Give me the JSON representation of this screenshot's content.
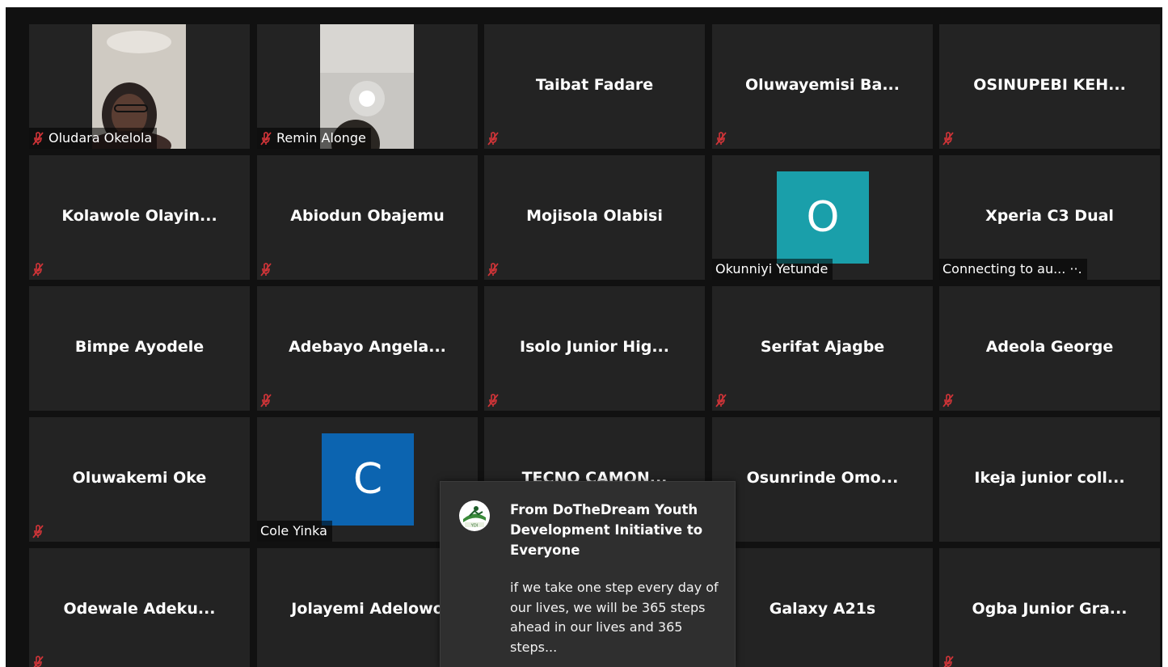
{
  "participants": [
    {
      "name": "Oludara Okelola",
      "muted": true,
      "display": "video"
    },
    {
      "name": "Remin Alonge",
      "muted": true,
      "display": "video"
    },
    {
      "name": "Taibat Fadare",
      "muted": true,
      "display": "name"
    },
    {
      "name": "Oluwayemisi  Ba...",
      "muted": true,
      "display": "name"
    },
    {
      "name": "OSINUPEBI  KEH...",
      "muted": true,
      "display": "name"
    },
    {
      "name": "Kolawole  Olayin...",
      "muted": true,
      "display": "name"
    },
    {
      "name": "Abiodun Obajemu",
      "muted": true,
      "display": "name"
    },
    {
      "name": "Mojisola Olabisi",
      "muted": true,
      "display": "name"
    },
    {
      "name": "Okunniyi Yetunde",
      "muted": false,
      "display": "avatar",
      "avatar_letter": "O",
      "avatar_color": "#1a9faa"
    },
    {
      "name": "Xperia C3 Dual",
      "muted": false,
      "display": "name",
      "status": "Connecting to au... ··."
    },
    {
      "name": "Bimpe Ayodele",
      "muted": false,
      "display": "name"
    },
    {
      "name": "Adebayo  Angela...",
      "muted": true,
      "display": "name"
    },
    {
      "name": "Isolo  Junior  Hig...",
      "muted": true,
      "display": "name"
    },
    {
      "name": "Serifat Ajagbe",
      "muted": true,
      "display": "name"
    },
    {
      "name": "Adeola George",
      "muted": true,
      "display": "name"
    },
    {
      "name": "Oluwakemi Oke",
      "muted": true,
      "display": "name"
    },
    {
      "name": "Cole Yinka",
      "muted": false,
      "display": "avatar",
      "avatar_letter": "C",
      "avatar_color": "#0c64b0"
    },
    {
      "name": "TECNO  CAMON...",
      "muted": false,
      "display": "name"
    },
    {
      "name": "Osunrinde  Omo...",
      "muted": false,
      "display": "name"
    },
    {
      "name": "Ikeja  junior  coll...",
      "muted": false,
      "display": "name"
    },
    {
      "name": "Odewale  Adeku...",
      "muted": true,
      "display": "name"
    },
    {
      "name": "Jolayemi Adelowo",
      "muted": false,
      "display": "name"
    },
    {
      "name": "",
      "muted": false,
      "display": "name"
    },
    {
      "name": "Galaxy A21s",
      "muted": false,
      "display": "name"
    },
    {
      "name": "Ogba  Junior  Gra...",
      "muted": true,
      "display": "name"
    }
  ],
  "chat_popup": {
    "header": "From DoTheDream Youth Development Initiative to Everyone",
    "message": "if we take one step every day of our lives, we will be 365 steps ahead in our lives and 365 steps...",
    "logo_icon": "dothedream-logo-icon"
  },
  "colors": {
    "tile_bg": "#232323",
    "stage_bg": "#111111",
    "mute_red": "#d13438",
    "popup_bg": "#2f2f2f"
  }
}
